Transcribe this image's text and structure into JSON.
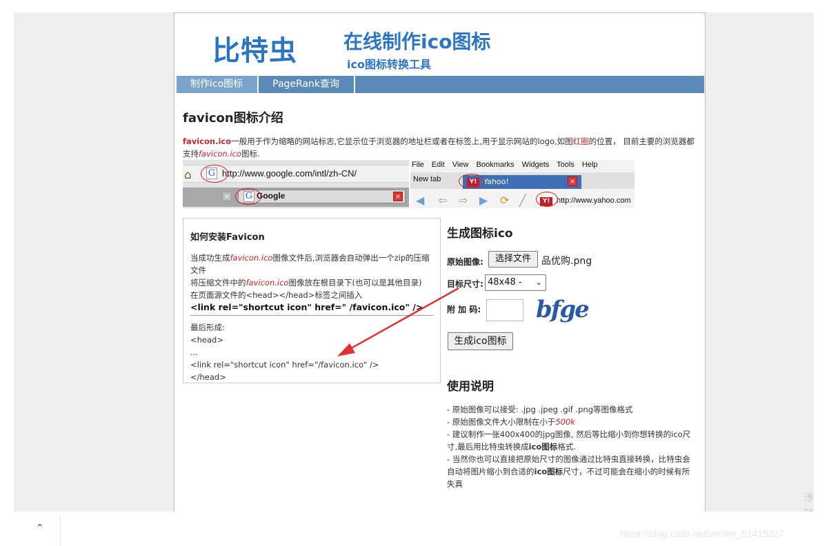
{
  "header": {
    "logo": "比特虫",
    "title": "在线制作ico图标",
    "subtitle": "ico图标转换工具"
  },
  "nav": [
    "制作ico图标",
    "PageRank查询"
  ],
  "intro": {
    "heading": "favicon图标介绍",
    "lead": "favicon.ico",
    "text1": "一般用于作为缩略的网站标志,它显示位于浏览器的地址栏或者在标签上,用于显示网站的logo,如图",
    "red_word": "红圈",
    "text2": "的位置， 目前主要的浏览器都支持",
    "italic": "favicon.ico",
    "text3": "图标."
  },
  "screenshot": {
    "url_left": "http://www.google.com/intl/zh-CN/",
    "tab_left": "Google",
    "menu": "File Edit View Bookmarks Widgets Tools Help",
    "new_tab": "New tab",
    "yahoo_tab": "Yahoo!",
    "url_right": "http://www.yahoo.com",
    "g_icon": "G",
    "y_icon": "Y!"
  },
  "install": {
    "heading": "如何安装Favicon",
    "l1a": "当成功生成",
    "l1b": "favicon.ico",
    "l1c": "图像文件后,浏览器会自动弹出一个zip的压缩文件",
    "l2a": "将压缩文件中的",
    "l2b": "favicon.ico",
    "l2c": "图像放在根目录下(也可以是其他目录)",
    "l3": "在页面源文件的<head></head>标签之间插入",
    "code": "<link rel=\"shortcut icon\" href=\" /favicon.ico\" />",
    "final_label": "最后形成:",
    "f1": "<head>",
    "f2": "...",
    "f3": "<link rel=\"shortcut icon\" href=\"/favicon.ico\" />",
    "f4": "</head>"
  },
  "generator": {
    "heading": "生成图标ico",
    "image_label": "原始图像:",
    "file_button": "选择文件",
    "file_name": "品优购.png",
    "size_label": "目标尺寸:",
    "size_value": "48x48 -",
    "code_label": "附 加 码:",
    "captcha": "bfge",
    "submit": "生成ico图标"
  },
  "usage": {
    "heading": "使用说明",
    "i1": "- 原始图像可以接受: .jpg .jpeg .gif .png等图像格式",
    "i2a": "- 原始图像文件大小限制在小于",
    "i2b": "500k",
    "i3a": "- 建议制作一张400x400的jpg图像, 然后等比缩小到你想转换的ico尺寸,最后用比特虫转换成",
    "i3b": "ico图标",
    "i3c": "格式.",
    "i4a": "- 当然你也可以直接把原始尺寸的图像通过比特虫直接转换，比特虫会自动将图片缩小到合适的",
    "i4b": "ico图标",
    "i4c": "尺寸，不过可能会在缩小的时候有所失真"
  },
  "footer": {
    "watermark": "https://blog.csdn.net/weixin_51415327",
    "side": "涉转"
  },
  "colors": {
    "brand": "#2c74c4",
    "nav": "#5b8ab8",
    "accent_red": "#cc2222"
  }
}
